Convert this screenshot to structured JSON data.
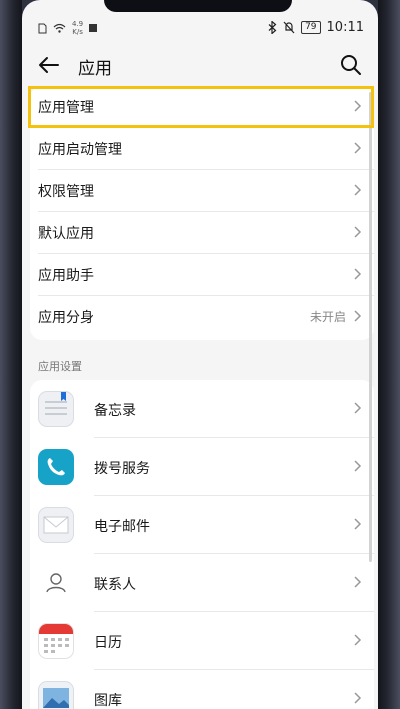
{
  "status_bar": {
    "speed": "4.9",
    "speed_unit": "K/s",
    "battery": "79",
    "time": "10:11"
  },
  "header": {
    "title": "应用"
  },
  "menu": {
    "items": [
      {
        "label": "应用管理",
        "value": ""
      },
      {
        "label": "应用启动管理",
        "value": ""
      },
      {
        "label": "权限管理",
        "value": ""
      },
      {
        "label": "默认应用",
        "value": ""
      },
      {
        "label": "应用助手",
        "value": ""
      },
      {
        "label": "应用分身",
        "value": "未开启"
      }
    ]
  },
  "app_settings": {
    "title": "应用设置",
    "items": [
      {
        "label": "备忘录",
        "icon": "notepad-icon"
      },
      {
        "label": "拨号服务",
        "icon": "phone-icon"
      },
      {
        "label": "电子邮件",
        "icon": "mail-icon"
      },
      {
        "label": "联系人",
        "icon": "contacts-icon"
      },
      {
        "label": "日历",
        "icon": "calendar-icon"
      },
      {
        "label": "图库",
        "icon": "gallery-icon"
      }
    ]
  },
  "colors": {
    "highlight": "#f4c20d",
    "phone_icon": "#16a3c7",
    "calendar_red": "#e53935"
  }
}
